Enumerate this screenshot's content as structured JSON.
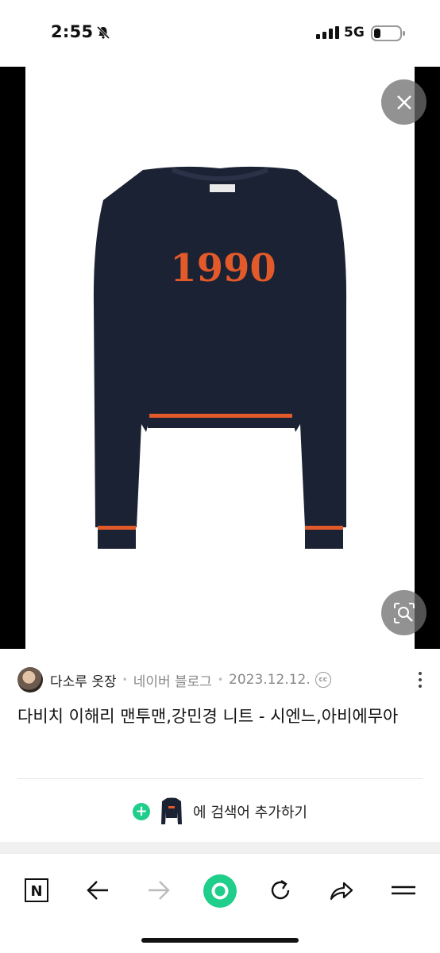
{
  "status_bar": {
    "time": "2:55",
    "network": "5G",
    "icons": [
      "bell-slash-icon",
      "signal-icon",
      "battery-icon"
    ]
  },
  "viewer": {
    "sweater_text": "1990",
    "icons": [
      "close-icon",
      "lens-search-icon"
    ]
  },
  "source": {
    "author": "다소루 옷장",
    "platform": "네이버 블로그",
    "date": "2023.12.12.",
    "license_icon": "cc-icon",
    "cc_label": "cc"
  },
  "title": "다비치 이해리 맨투맨,강민경 니트 - 시엔느,아비에무아",
  "add_search": {
    "label": "에 검색어 추가하기"
  },
  "toolbar": {
    "n_label": "N",
    "icons": [
      "naver-home-icon",
      "back-arrow-icon",
      "forward-arrow-icon",
      "green-dot-icon",
      "refresh-icon",
      "share-icon",
      "menu-icon"
    ]
  },
  "colors": {
    "accent_green": "#1fce8b",
    "sweater_navy": "#1b2233",
    "sweater_orange": "#e2592a"
  }
}
